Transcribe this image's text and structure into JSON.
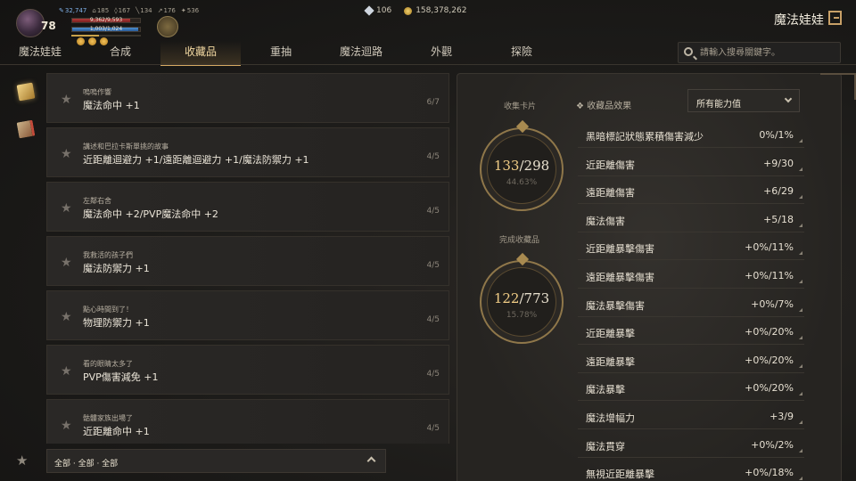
{
  "hud": {
    "level": "78",
    "stats": {
      "mana": "32,747",
      "s1": "185",
      "s2": "167",
      "s3": "134",
      "s4": "176",
      "s5": "536"
    },
    "hp_text": "9,362/9,593",
    "mp_text": "1,003/1,024"
  },
  "currency": {
    "gem": "106",
    "gold": "158,378,262"
  },
  "window": {
    "title": "魔法娃娃"
  },
  "tabs": [
    "魔法娃娃",
    "合成",
    "收藏品",
    "重抽",
    "魔法迴路",
    "外觀",
    "探險"
  ],
  "active_tab": "收藏品",
  "search": {
    "placeholder": "請輸入搜尋關鍵字。"
  },
  "list": [
    {
      "sub": "嗚嗚作響",
      "main": "魔法命中 +1",
      "progress": "6/7"
    },
    {
      "sub": "講述和巴拉卡斯單挑的故事",
      "main": "近距離迴避力 +1/遠距離迴避力 +1/魔法防禦力 +1",
      "progress": "4/5"
    },
    {
      "sub": "左鄰右舍",
      "main": "魔法命中 +2/PVP魔法命中 +2",
      "progress": "4/5"
    },
    {
      "sub": "我救活的孩子們",
      "main": "魔法防禦力 +1",
      "progress": "4/5"
    },
    {
      "sub": "點心時間到了！",
      "main": "物理防禦力 +1",
      "progress": "4/5"
    },
    {
      "sub": "看的眼睛太多了",
      "main": "PVP傷害減免 +1",
      "progress": "4/5"
    },
    {
      "sub": "骷髏家族出場了",
      "main": "近距離命中 +1",
      "progress": "4/5"
    }
  ],
  "filter": {
    "label": "全部 · 全部 · 全部"
  },
  "panel": {
    "cards_label": "收集卡片",
    "cards": {
      "have": "133",
      "total": "/298",
      "pct": "44.63%"
    },
    "complete_label": "完成收藏品",
    "complete": {
      "have": "122",
      "total": "/773",
      "pct": "15.78%"
    },
    "effects_label": "❖ 收藏品效果",
    "dropdown_value": "所有能力值"
  },
  "effects": [
    {
      "name": "黑暗標記狀態累積傷害減少",
      "value": "0%/1%"
    },
    {
      "name": "近距離傷害",
      "value": "+9/30"
    },
    {
      "name": "遠距離傷害",
      "value": "+6/29"
    },
    {
      "name": "魔法傷害",
      "value": "+5/18"
    },
    {
      "name": "近距離暴擊傷害",
      "value": "+0%/11%"
    },
    {
      "name": "遠距離暴擊傷害",
      "value": "+0%/11%"
    },
    {
      "name": "魔法暴擊傷害",
      "value": "+0%/7%"
    },
    {
      "name": "近距離暴擊",
      "value": "+0%/20%"
    },
    {
      "name": "遠距離暴擊",
      "value": "+0%/20%"
    },
    {
      "name": "魔法暴擊",
      "value": "+0%/20%"
    },
    {
      "name": "魔法增幅力",
      "value": "+3/9"
    },
    {
      "name": "魔法貫穿",
      "value": "+0%/2%"
    },
    {
      "name": "無視近距離暴擊",
      "value": "+0%/18%"
    }
  ]
}
